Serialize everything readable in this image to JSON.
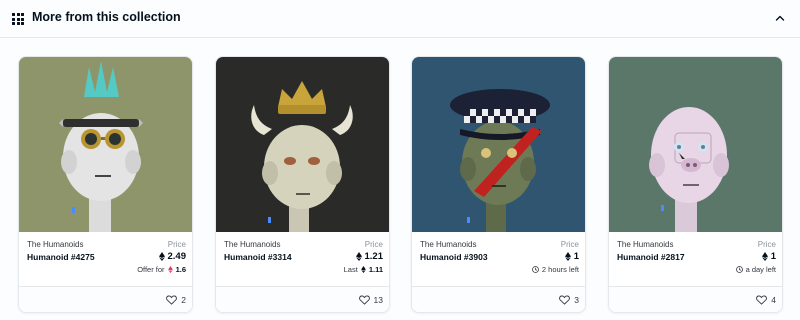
{
  "section": {
    "title": "More from this collection",
    "grid_icon": "grid-icon",
    "collapse_icon": "chevron-up-icon"
  },
  "currency_icon": "ethereum-icon",
  "colors": {
    "text_primary": "#04111d",
    "text_secondary": "#8a939b",
    "border": "#e5e8eb",
    "offer_eth": "#e2396b"
  },
  "cards": [
    {
      "collection": "The Humanoids",
      "name": "Humanoid #4275",
      "price_label": "Price",
      "price": "2.49",
      "sub_label": "Offer for",
      "sub_value": "1.6",
      "sub_icon": "ethereum-icon",
      "favorites": "2",
      "image_bg": "#8f956a"
    },
    {
      "collection": "The Humanoids",
      "name": "Humanoid #3314",
      "price_label": "Price",
      "price": "1.21",
      "sub_label": "Last",
      "sub_value": "1.11",
      "sub_icon": "ethereum-icon",
      "favorites": "13",
      "image_bg": "#2a2b29"
    },
    {
      "collection": "The Humanoids",
      "name": "Humanoid #3903",
      "price_label": "Price",
      "price": "1",
      "sub_label": "2 hours left",
      "sub_icon": "clock-icon",
      "favorites": "3",
      "image_bg": "#2f5571"
    },
    {
      "collection": "The Humanoids",
      "name": "Humanoid #2817",
      "price_label": "Price",
      "price": "1",
      "sub_label": "a day left",
      "sub_icon": "clock-icon",
      "favorites": "4",
      "image_bg": "#5b776a"
    }
  ]
}
